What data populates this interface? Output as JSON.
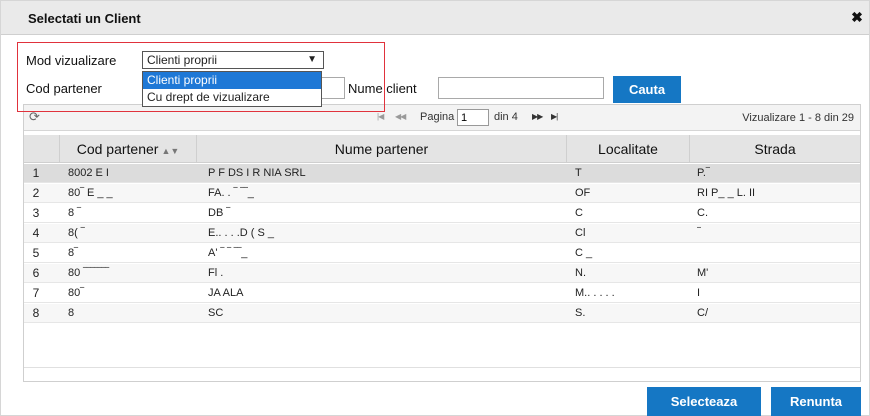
{
  "dialog": {
    "title": "Selectati un Client",
    "close_glyph": "✖"
  },
  "filters": {
    "mod_label": "Mod vizualizare",
    "mod_selected": "Clienti proprii",
    "mod_options": [
      "Clienti proprii",
      "Cu drept de vizualizare"
    ],
    "cod_label": "Cod partener",
    "cod_value": "",
    "nume_label": "Nume client",
    "nume_value": "",
    "search_button": "Cauta"
  },
  "pager": {
    "page_label": "Pagina",
    "page_value": "1",
    "of_label": "din 4",
    "view_info": "Vizualizare 1 - 8 din 29"
  },
  "table": {
    "columns": [
      "Cod partener",
      "Nume partener",
      "Localitate",
      "Strada"
    ],
    "rows": [
      {
        "n": "1",
        "cod": "8002  E  I",
        "nume": "P    F  DS    I           R       NIA SRL",
        "loc": "T",
        "str": "P.‾"
      },
      {
        "n": "2",
        "cod": "80‾   E  _  _",
        "nume": "FA. .   ‾  ‾‾_",
        "loc": "OF",
        "str": "RI  P_ _ L.  II"
      },
      {
        "n": "3",
        "cod": "8  ‾",
        "nume": "DB ‾",
        "loc": "C",
        "str": "C."
      },
      {
        "n": "4",
        "cod": "8(        ‾",
        "nume": "E.. . . .D       (            S  _",
        "loc": "Cl",
        "str": "‾"
      },
      {
        "n": "5",
        "cod": "8‾",
        "nume": "A'    ‾       ‾  ‾‾_",
        "loc": "C  _",
        "str": ""
      },
      {
        "n": "6",
        "cod": "80  ‾‾‾‾‾‾‾",
        "nume": "Fl                     .",
        "loc": "N.",
        "str": "M'"
      },
      {
        "n": "7",
        "cod": "80‾",
        "nume": "JA                                                          ALA",
        "loc": "M.. . . . .",
        "str": "I"
      },
      {
        "n": "8",
        "cod": "8",
        "nume": "SC",
        "loc": "S.",
        "str": "C/"
      }
    ]
  },
  "actions": {
    "select_button": "Selecteaza",
    "cancel_button": "Renunta"
  },
  "colors": {
    "accent": "#1577c4",
    "highlight": "#e0323c",
    "selected_option": "#1e78d6"
  }
}
